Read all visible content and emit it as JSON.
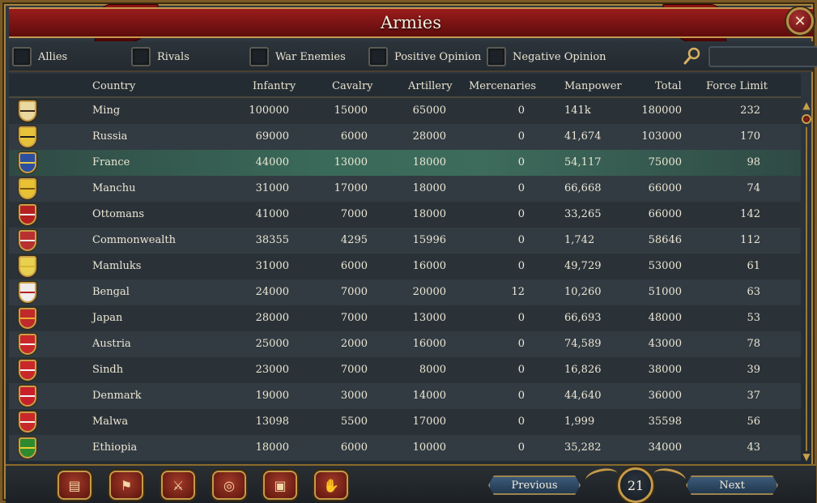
{
  "window": {
    "title": "Armies",
    "close_glyph": "✕"
  },
  "filters": [
    {
      "label": "Allies"
    },
    {
      "label": "Rivals"
    },
    {
      "label": "War Enemies"
    },
    {
      "label": "Positive Opinion"
    },
    {
      "label": "Negative Opinion"
    }
  ],
  "search": {
    "icon": "search-icon",
    "value": ""
  },
  "table": {
    "headers": {
      "country": "Country",
      "infantry": "Infantry",
      "cavalry": "Cavalry",
      "artillery": "Artillery",
      "mercenaries": "Mercenaries",
      "manpower": "Manpower",
      "total": "Total",
      "force_limit": "Force Limit"
    },
    "selected_row": 2,
    "rows": [
      {
        "country": "Ming",
        "infantry": "100000",
        "cavalry": "15000",
        "artillery": "65000",
        "mercenaries": "0",
        "manpower": "141k",
        "total": "180000",
        "force_limit": "232",
        "flag_colors": [
          "#e9d8a0",
          "#3a2a1a"
        ]
      },
      {
        "country": "Russia",
        "infantry": "69000",
        "cavalry": "6000",
        "artillery": "28000",
        "mercenaries": "0",
        "manpower": "41,674",
        "total": "103000",
        "force_limit": "170",
        "flag_colors": [
          "#e6c23a",
          "#1c1c1c"
        ]
      },
      {
        "country": "France",
        "infantry": "44000",
        "cavalry": "13000",
        "artillery": "18000",
        "mercenaries": "0",
        "manpower": "54,117",
        "total": "75000",
        "force_limit": "98",
        "flag_colors": [
          "#2c4fa0",
          "#e9c84a"
        ]
      },
      {
        "country": "Manchu",
        "infantry": "31000",
        "cavalry": "17000",
        "artillery": "18000",
        "mercenaries": "0",
        "manpower": "66,668",
        "total": "66000",
        "force_limit": "74",
        "flag_colors": [
          "#e8c232",
          "#7a5a10"
        ]
      },
      {
        "country": "Ottomans",
        "infantry": "41000",
        "cavalry": "7000",
        "artillery": "18000",
        "mercenaries": "0",
        "manpower": "33,265",
        "total": "66000",
        "force_limit": "142",
        "flag_colors": [
          "#b52020",
          "#f0f0f0"
        ]
      },
      {
        "country": "Commonwealth",
        "infantry": "38355",
        "cavalry": "4295",
        "artillery": "15996",
        "mercenaries": "0",
        "manpower": "1,742",
        "total": "58646",
        "force_limit": "112",
        "flag_colors": [
          "#b83030",
          "#e8e8e8"
        ]
      },
      {
        "country": "Mamluks",
        "infantry": "31000",
        "cavalry": "6000",
        "artillery": "16000",
        "mercenaries": "0",
        "manpower": "49,729",
        "total": "53000",
        "force_limit": "61",
        "flag_colors": [
          "#e8d050",
          "#d8b830"
        ]
      },
      {
        "country": "Bengal",
        "infantry": "24000",
        "cavalry": "7000",
        "artillery": "20000",
        "mercenaries": "12",
        "manpower": "10,260",
        "total": "51000",
        "force_limit": "63",
        "flag_colors": [
          "#f0ecec",
          "#b52020"
        ]
      },
      {
        "country": "Japan",
        "infantry": "28000",
        "cavalry": "7000",
        "artillery": "13000",
        "mercenaries": "0",
        "manpower": "66,693",
        "total": "48000",
        "force_limit": "53",
        "flag_colors": [
          "#c02a2a",
          "#e8b030"
        ]
      },
      {
        "country": "Austria",
        "infantry": "25000",
        "cavalry": "2000",
        "artillery": "16000",
        "mercenaries": "0",
        "manpower": "74,589",
        "total": "43000",
        "force_limit": "78",
        "flag_colors": [
          "#c8282a",
          "#f5f5f5"
        ]
      },
      {
        "country": "Sindh",
        "infantry": "23000",
        "cavalry": "7000",
        "artillery": "8000",
        "mercenaries": "0",
        "manpower": "16,826",
        "total": "38000",
        "force_limit": "39",
        "flag_colors": [
          "#c8282a",
          "#f5f5f5"
        ]
      },
      {
        "country": "Denmark",
        "infantry": "19000",
        "cavalry": "3000",
        "artillery": "14000",
        "mercenaries": "0",
        "manpower": "44,640",
        "total": "36000",
        "force_limit": "37",
        "flag_colors": [
          "#c8202a",
          "#f5f5f5"
        ]
      },
      {
        "country": "Malwa",
        "infantry": "13098",
        "cavalry": "5500",
        "artillery": "17000",
        "mercenaries": "0",
        "manpower": "1,999",
        "total": "35598",
        "force_limit": "56",
        "flag_colors": [
          "#c8282a",
          "#f5f5f5"
        ]
      },
      {
        "country": "Ethiopia",
        "infantry": "18000",
        "cavalry": "6000",
        "artillery": "10000",
        "mercenaries": "0",
        "manpower": "35,282",
        "total": "34000",
        "force_limit": "43",
        "flag_colors": [
          "#2e8a2e",
          "#e8d030"
        ]
      }
    ]
  },
  "bottom": {
    "tabs": [
      {
        "name": "ledger-tab",
        "glyph": "▤"
      },
      {
        "name": "flag-tab",
        "glyph": "⚑"
      },
      {
        "name": "crossed-swords-tab",
        "glyph": "⚔"
      },
      {
        "name": "coins-tab",
        "glyph": "◎"
      },
      {
        "name": "chest-tab",
        "glyph": "▣"
      },
      {
        "name": "handshake-tab",
        "glyph": "✋"
      }
    ],
    "previous_label": "Previous",
    "next_label": "Next",
    "page": "21"
  },
  "colors": {
    "accent_gold": "#c49a4a",
    "title_red": "#8c1212",
    "selected_row": "#3a6a5a"
  }
}
